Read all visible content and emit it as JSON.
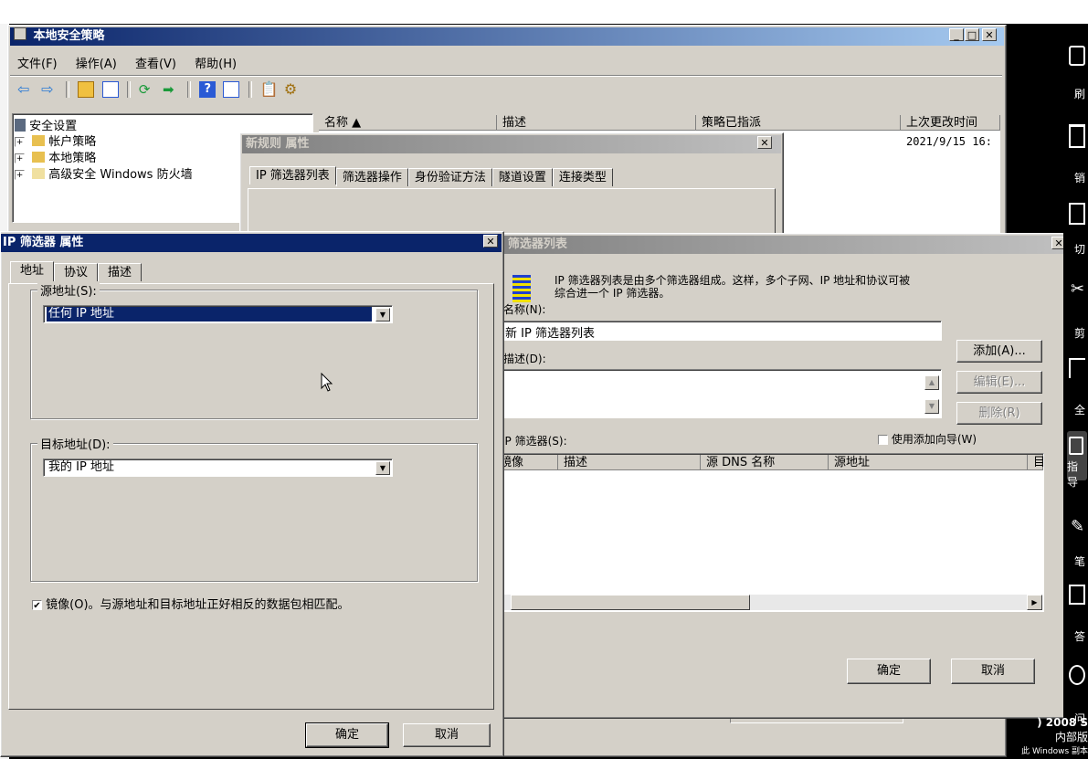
{
  "main_window": {
    "title": "本地安全策略",
    "menu": [
      "文件(F)",
      "操作(A)",
      "查看(V)",
      "帮助(H)"
    ],
    "tree": [
      "安全设置",
      "帐户策略",
      "本地策略",
      "高级安全 Windows 防火墙"
    ],
    "columns": [
      "名称 ▲",
      "描述",
      "策略已指派",
      "上次更改时间"
    ],
    "row_time": "2021/9/15 16:"
  },
  "rule_dialog": {
    "title": "新规则 属性",
    "tabs": [
      "IP 筛选器列表",
      "筛选器操作",
      "身份验证方法",
      "隧道设置",
      "连接类型"
    ]
  },
  "filter_list_dialog": {
    "title": "IP 筛选器列表",
    "description_line1": "IP 筛选器列表是由多个筛选器组成。这样，多个子网、IP 地址和协议可被",
    "description_line2": "综合进一个 IP 筛选器。",
    "name_label": "名称(N):",
    "name_value": "新 IP 筛选器列表",
    "desc_label": "描述(D):",
    "add_button": "添加(A)...",
    "edit_button": "编辑(E)...",
    "delete_button": "删除(R)",
    "filters_label": "IP 筛选器(S):",
    "use_wizard": "使用添加向导(W)",
    "columns": [
      "镜像",
      "描述",
      "源 DNS 名称",
      "源地址",
      "目"
    ],
    "ok_button": "确定",
    "cancel_button": "取消"
  },
  "filter_props_dialog": {
    "title": "IP 筛选器 属性",
    "tabs": [
      "地址",
      "协议",
      "描述"
    ],
    "source_group": "源地址(S):",
    "source_value": "任何 IP 地址",
    "dest_group": "目标地址(D):",
    "dest_value": "我的 IP 地址",
    "mirror_label": "镜像(O)。与源地址和目标地址正好相反的数据包相匹配。",
    "mirror_checked": "✔",
    "ok_button": "确定",
    "cancel_button": "取消"
  },
  "desktop": {
    "side_labels": [
      "刷",
      "销",
      "切",
      "剪",
      "全",
      "指导",
      "笔",
      "答",
      "问"
    ],
    "watermark_line1": ") 2008 S",
    "watermark_line2": "内部版",
    "watermark_line3": "此 Windows 副本"
  }
}
